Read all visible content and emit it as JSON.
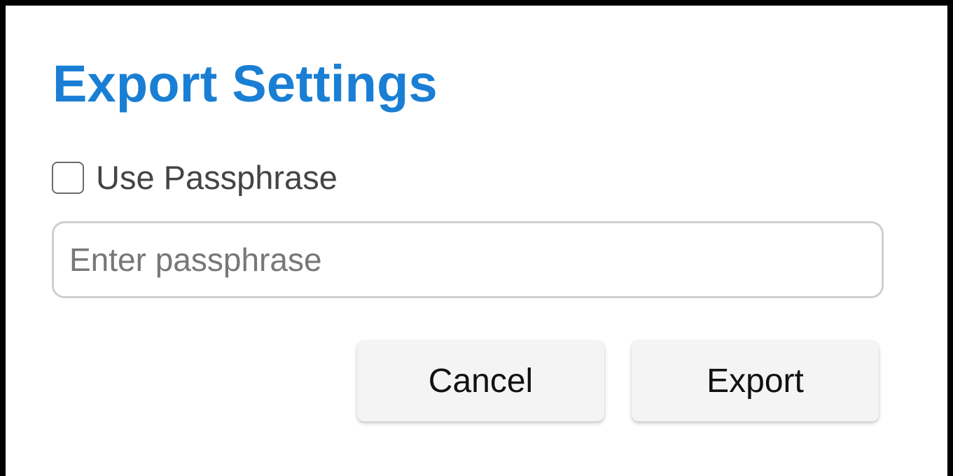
{
  "dialog": {
    "title": "Export Settings",
    "title_color": "#1a7fd4",
    "passphrase_checkbox": {
      "label": "Use Passphrase",
      "checked": false
    },
    "passphrase_input": {
      "value": "",
      "placeholder": "Enter passphrase"
    },
    "buttons": {
      "cancel_label": "Cancel",
      "export_label": "Export"
    }
  }
}
